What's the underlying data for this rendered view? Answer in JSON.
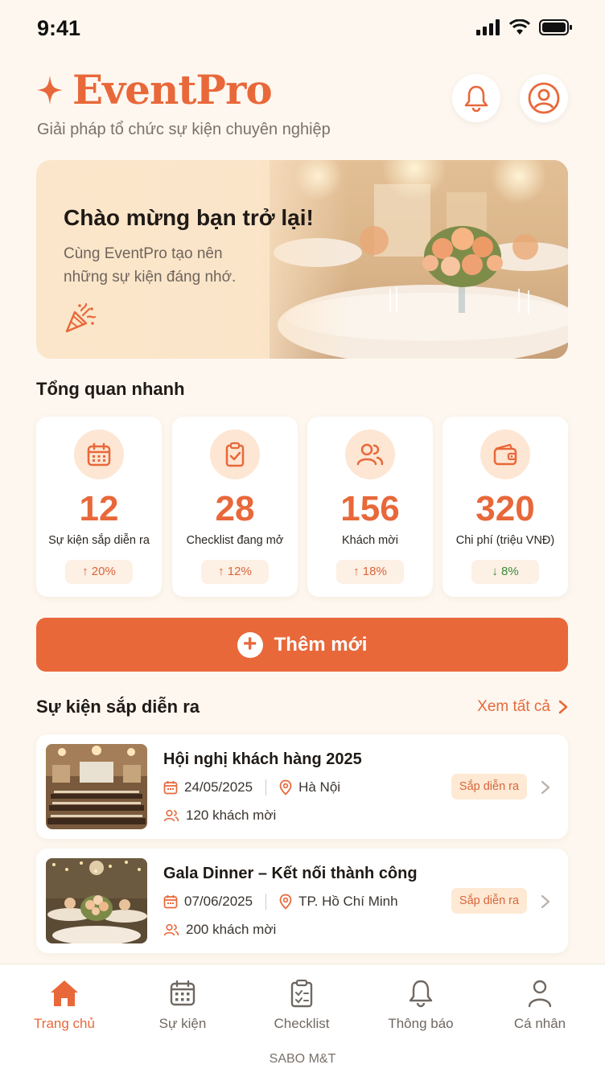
{
  "status": {
    "time": "9:41"
  },
  "header": {
    "app_name": "EventPro",
    "tagline": "Giải pháp tổ chức sự kiện chuyên nghiệp",
    "accent": "#e8683a"
  },
  "hero": {
    "title": "Chào mừng bạn trở lại!",
    "subtitle_line1": "Cùng EventPro tạo nên",
    "subtitle_line2": "những sự kiện đáng nhớ."
  },
  "overview": {
    "title": "Tổng quan nhanh",
    "stats": [
      {
        "icon": "calendar-icon",
        "value": "12",
        "label": "Sự kiện sắp diễn ra",
        "trend": "↑ 20%",
        "direction": "up"
      },
      {
        "icon": "clipboard-icon",
        "value": "28",
        "label": "Checklist đang mở",
        "trend": "↑ 12%",
        "direction": "up"
      },
      {
        "icon": "users-icon",
        "value": "156",
        "label": "Khách mời",
        "trend": "↑ 18%",
        "direction": "up"
      },
      {
        "icon": "wallet-icon",
        "value": "320",
        "label": "Chi phí (triệu VNĐ)",
        "trend": "↓ 8%",
        "direction": "down"
      }
    ]
  },
  "add_button": {
    "label": "Thêm mới"
  },
  "events": {
    "title": "Sự kiện sắp diễn ra",
    "see_all": "Xem tất cả",
    "items": [
      {
        "title": "Hội nghị khách hàng 2025",
        "date": "24/05/2025",
        "location": "Hà Nội",
        "guests": "120 khách mời",
        "status": "Sắp diễn ra"
      },
      {
        "title": "Gala Dinner – Kết nối thành công",
        "date": "07/06/2025",
        "location": "TP. Hồ Chí Minh",
        "guests": "200 khách mời",
        "status": "Sắp diễn ra"
      }
    ]
  },
  "nav": {
    "items": [
      {
        "label": "Trang chủ",
        "icon": "home-icon",
        "active": true
      },
      {
        "label": "Sự kiện",
        "icon": "calendar-icon"
      },
      {
        "label": "Checklist",
        "icon": "clipboard-icon"
      },
      {
        "label": "Thông báo",
        "icon": "bell-icon"
      },
      {
        "label": "Cá nhân",
        "icon": "user-icon"
      }
    ]
  },
  "footer": {
    "text": "SABO M&T"
  }
}
